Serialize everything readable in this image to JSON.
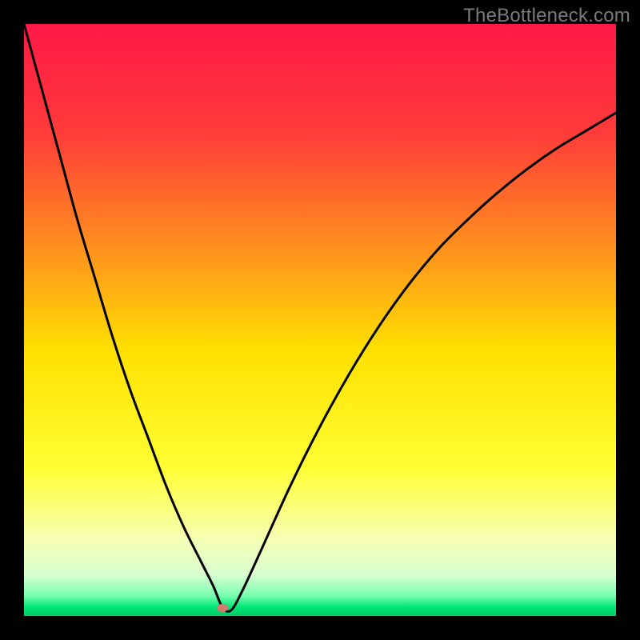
{
  "watermark": "TheBottleneck.com",
  "chart_data": {
    "type": "line",
    "title": "",
    "xlabel": "",
    "ylabel": "",
    "xlim": [
      0,
      100
    ],
    "ylim": [
      0,
      100
    ],
    "grid": false,
    "background_gradient": {
      "type": "vertical",
      "stops": [
        {
          "offset": 0.0,
          "color": "#ff1846"
        },
        {
          "offset": 0.18,
          "color": "#ff3a3a"
        },
        {
          "offset": 0.4,
          "color": "#ff9a1a"
        },
        {
          "offset": 0.55,
          "color": "#ffe000"
        },
        {
          "offset": 0.75,
          "color": "#ffff33"
        },
        {
          "offset": 0.87,
          "color": "#f6ffb3"
        },
        {
          "offset": 0.93,
          "color": "#d8ffd0"
        },
        {
          "offset": 0.965,
          "color": "#7bffb0"
        },
        {
          "offset": 0.985,
          "color": "#00e676"
        },
        {
          "offset": 1.0,
          "color": "#00c864"
        }
      ]
    },
    "series": [
      {
        "name": "bottleneck-curve",
        "color": "#000000",
        "stroke_width": 3,
        "x": [
          0,
          3,
          6,
          9,
          12,
          15,
          18,
          21,
          24,
          27,
          30,
          32,
          33.5,
          35,
          37,
          40,
          45,
          50,
          55,
          60,
          65,
          70,
          75,
          80,
          85,
          90,
          95,
          100
        ],
        "y": [
          100,
          89,
          78,
          67,
          57,
          47,
          38,
          30,
          22,
          15,
          9,
          5,
          1.5,
          1.0,
          4.5,
          11,
          22,
          32,
          41,
          49,
          56,
          62,
          67,
          71.5,
          75.5,
          79,
          82,
          85
        ]
      }
    ],
    "marker": {
      "name": "optimum-point",
      "x": 33.5,
      "y": 1.3,
      "color": "#d47a6e"
    }
  }
}
